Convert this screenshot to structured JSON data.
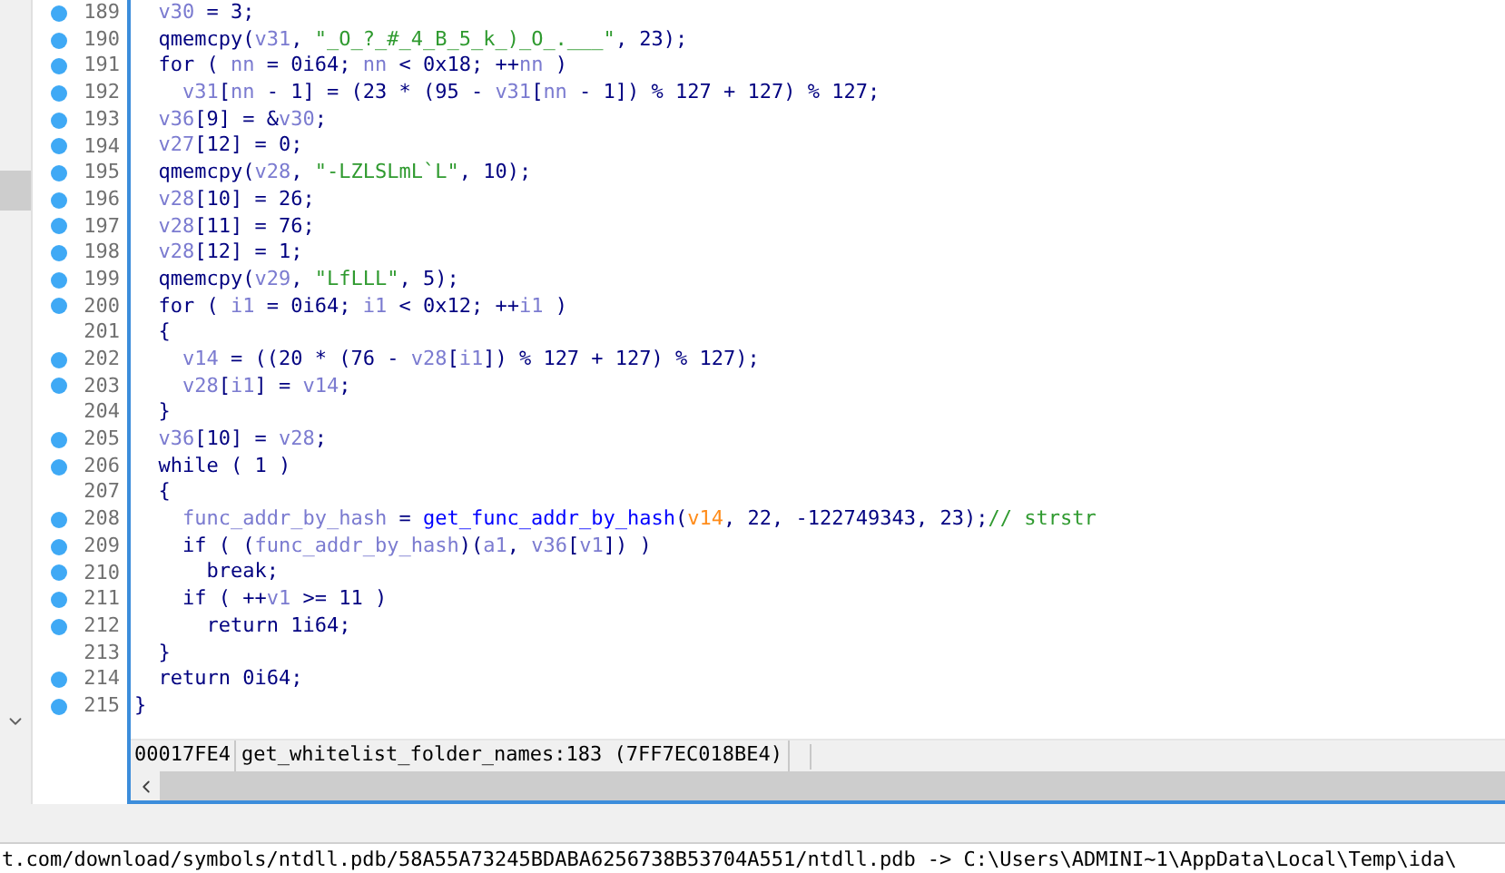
{
  "code_lines": [
    {
      "number": "189",
      "marker": true,
      "tokens": [
        {
          "kind": "var",
          "text": "  v30"
        },
        {
          "kind": "plain",
          "text": " = 3;"
        }
      ]
    },
    {
      "number": "190",
      "marker": true,
      "tokens": [
        {
          "kind": "plain",
          "text": "  qmemcpy("
        },
        {
          "kind": "var",
          "text": "v31"
        },
        {
          "kind": "plain",
          "text": ", "
        },
        {
          "kind": "str",
          "text": "\"_O_?_#_4_B_5_k_)_O_.___\""
        },
        {
          "kind": "plain",
          "text": ", 23);"
        }
      ]
    },
    {
      "number": "191",
      "marker": true,
      "tokens": [
        {
          "kind": "plain",
          "text": "  for ( "
        },
        {
          "kind": "var",
          "text": "nn"
        },
        {
          "kind": "plain",
          "text": " = 0i64; "
        },
        {
          "kind": "var",
          "text": "nn"
        },
        {
          "kind": "plain",
          "text": " < 0x18; ++"
        },
        {
          "kind": "var",
          "text": "nn"
        },
        {
          "kind": "plain",
          "text": " )"
        }
      ]
    },
    {
      "number": "192",
      "marker": true,
      "tokens": [
        {
          "kind": "var",
          "text": "    v31"
        },
        {
          "kind": "plain",
          "text": "["
        },
        {
          "kind": "var",
          "text": "nn"
        },
        {
          "kind": "plain",
          "text": " - 1] = (23 * (95 - "
        },
        {
          "kind": "var",
          "text": "v31"
        },
        {
          "kind": "plain",
          "text": "["
        },
        {
          "kind": "var",
          "text": "nn"
        },
        {
          "kind": "plain",
          "text": " - 1]) % 127 + 127) % 127;"
        }
      ]
    },
    {
      "number": "193",
      "marker": true,
      "tokens": [
        {
          "kind": "var",
          "text": "  v36"
        },
        {
          "kind": "plain",
          "text": "[9] = &"
        },
        {
          "kind": "var",
          "text": "v30"
        },
        {
          "kind": "plain",
          "text": ";"
        }
      ]
    },
    {
      "number": "194",
      "marker": true,
      "tokens": [
        {
          "kind": "var",
          "text": "  v27"
        },
        {
          "kind": "plain",
          "text": "[12] = 0;"
        }
      ]
    },
    {
      "number": "195",
      "marker": true,
      "tokens": [
        {
          "kind": "plain",
          "text": "  qmemcpy("
        },
        {
          "kind": "var",
          "text": "v28"
        },
        {
          "kind": "plain",
          "text": ", "
        },
        {
          "kind": "str",
          "text": "\"-LZLSLmL`L\""
        },
        {
          "kind": "plain",
          "text": ", 10);"
        }
      ]
    },
    {
      "number": "196",
      "marker": true,
      "tokens": [
        {
          "kind": "var",
          "text": "  v28"
        },
        {
          "kind": "plain",
          "text": "[10] = 26;"
        }
      ]
    },
    {
      "number": "197",
      "marker": true,
      "tokens": [
        {
          "kind": "var",
          "text": "  v28"
        },
        {
          "kind": "plain",
          "text": "[11] = 76;"
        }
      ]
    },
    {
      "number": "198",
      "marker": true,
      "tokens": [
        {
          "kind": "var",
          "text": "  v28"
        },
        {
          "kind": "plain",
          "text": "[12] = 1;"
        }
      ]
    },
    {
      "number": "199",
      "marker": true,
      "tokens": [
        {
          "kind": "plain",
          "text": "  qmemcpy("
        },
        {
          "kind": "var",
          "text": "v29"
        },
        {
          "kind": "plain",
          "text": ", "
        },
        {
          "kind": "str",
          "text": "\"LfLLL\""
        },
        {
          "kind": "plain",
          "text": ", 5);"
        }
      ]
    },
    {
      "number": "200",
      "marker": true,
      "tokens": [
        {
          "kind": "plain",
          "text": "  for ( "
        },
        {
          "kind": "var",
          "text": "i1"
        },
        {
          "kind": "plain",
          "text": " = 0i64; "
        },
        {
          "kind": "var",
          "text": "i1"
        },
        {
          "kind": "plain",
          "text": " < 0x12; ++"
        },
        {
          "kind": "var",
          "text": "i1"
        },
        {
          "kind": "plain",
          "text": " )"
        }
      ]
    },
    {
      "number": "201",
      "marker": false,
      "tokens": [
        {
          "kind": "plain",
          "text": "  {"
        }
      ]
    },
    {
      "number": "202",
      "marker": true,
      "tokens": [
        {
          "kind": "var",
          "text": "    v14"
        },
        {
          "kind": "plain",
          "text": " = ((20 * (76 - "
        },
        {
          "kind": "var",
          "text": "v28"
        },
        {
          "kind": "plain",
          "text": "["
        },
        {
          "kind": "var",
          "text": "i1"
        },
        {
          "kind": "plain",
          "text": "]) % 127 + 127) % 127);"
        }
      ]
    },
    {
      "number": "203",
      "marker": true,
      "tokens": [
        {
          "kind": "var",
          "text": "    v28"
        },
        {
          "kind": "plain",
          "text": "["
        },
        {
          "kind": "var",
          "text": "i1"
        },
        {
          "kind": "plain",
          "text": "] = "
        },
        {
          "kind": "var",
          "text": "v14"
        },
        {
          "kind": "plain",
          "text": ";"
        }
      ]
    },
    {
      "number": "204",
      "marker": false,
      "tokens": [
        {
          "kind": "plain",
          "text": "  }"
        }
      ]
    },
    {
      "number": "205",
      "marker": true,
      "tokens": [
        {
          "kind": "var",
          "text": "  v36"
        },
        {
          "kind": "plain",
          "text": "[10] = "
        },
        {
          "kind": "var",
          "text": "v28"
        },
        {
          "kind": "plain",
          "text": ";"
        }
      ]
    },
    {
      "number": "206",
      "marker": true,
      "tokens": [
        {
          "kind": "plain",
          "text": "  while ( 1 )"
        }
      ]
    },
    {
      "number": "207",
      "marker": false,
      "tokens": [
        {
          "kind": "plain",
          "text": "  {"
        }
      ]
    },
    {
      "number": "208",
      "marker": true,
      "tokens": [
        {
          "kind": "var",
          "text": "    func_addr_by_hash"
        },
        {
          "kind": "plain",
          "text": " = "
        },
        {
          "kind": "call",
          "text": "get_func_addr_by_hash"
        },
        {
          "kind": "plain",
          "text": "("
        },
        {
          "kind": "arg",
          "text": "v14"
        },
        {
          "kind": "plain",
          "text": ", 22, -122749343, 23);"
        },
        {
          "kind": "comment",
          "text": "// strstr"
        }
      ]
    },
    {
      "number": "209",
      "marker": true,
      "tokens": [
        {
          "kind": "plain",
          "text": "    if ( ("
        },
        {
          "kind": "var",
          "text": "func_addr_by_hash"
        },
        {
          "kind": "plain",
          "text": ")("
        },
        {
          "kind": "var",
          "text": "a1"
        },
        {
          "kind": "plain",
          "text": ", "
        },
        {
          "kind": "var",
          "text": "v36"
        },
        {
          "kind": "plain",
          "text": "["
        },
        {
          "kind": "var",
          "text": "v1"
        },
        {
          "kind": "plain",
          "text": "]) )"
        }
      ]
    },
    {
      "number": "210",
      "marker": true,
      "tokens": [
        {
          "kind": "plain",
          "text": "      break;"
        }
      ]
    },
    {
      "number": "211",
      "marker": true,
      "tokens": [
        {
          "kind": "plain",
          "text": "    if ( ++"
        },
        {
          "kind": "var",
          "text": "v1"
        },
        {
          "kind": "plain",
          "text": " >= 11 )"
        }
      ]
    },
    {
      "number": "212",
      "marker": true,
      "tokens": [
        {
          "kind": "plain",
          "text": "      return 1i64;"
        }
      ]
    },
    {
      "number": "213",
      "marker": false,
      "tokens": [
        {
          "kind": "plain",
          "text": "  }"
        }
      ]
    },
    {
      "number": "214",
      "marker": true,
      "tokens": [
        {
          "kind": "plain",
          "text": "  return 0i64;"
        }
      ]
    },
    {
      "number": "215",
      "marker": true,
      "tokens": [
        {
          "kind": "plain",
          "text": "}"
        }
      ]
    }
  ],
  "status": {
    "address": "00017FE4",
    "location": "get_whitelist_folder_names:183 (7FF7EC018BE4)"
  },
  "output_line": "t.com/download/symbols/ntdll.pdb/58A55A73245BDABA6256738B53704A551/ntdll.pdb -> C:\\Users\\ADMINI~1\\AppData\\Local\\Temp\\ida\\"
}
